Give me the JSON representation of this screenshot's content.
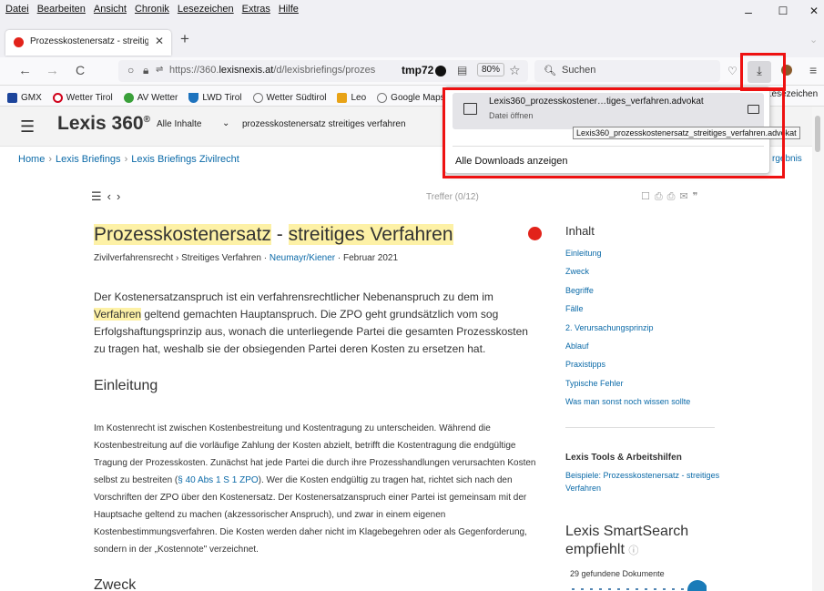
{
  "menu": [
    "Datei",
    "Bearbeiten",
    "Ansicht",
    "Chronik",
    "Lesezeichen",
    "Extras",
    "Hilfe"
  ],
  "window": {
    "minimize": "–",
    "maximize": "☐",
    "close": "✕"
  },
  "tab": {
    "title": "Prozesskostenersatz - streitiges",
    "close": "✕",
    "new": "+"
  },
  "nav": {
    "back": "←",
    "forward": "→",
    "reload": "C",
    "url_prefix": "https://360.",
    "url_domain": "lexisnexis.at",
    "url_rest": "/d/lexisbriefings/prozes",
    "url_tail": "tmp72",
    "zoom": "80%",
    "search_placeholder": "Suchen"
  },
  "bookmarks": [
    {
      "label": "GMX",
      "color": "#1c449b"
    },
    {
      "label": "Wetter Tirol",
      "color": "#d0021b"
    },
    {
      "label": "AV Wetter",
      "color": "#3aa03a"
    },
    {
      "label": "LWD Tirol",
      "color": "#1e73be"
    },
    {
      "label": "Wetter Südtirol",
      "color": "#777777"
    },
    {
      "label": "Leo",
      "color": "#e8a317"
    },
    {
      "label": "Google Maps",
      "color": "#777777"
    }
  ],
  "bookmarks_more": "Lesezeichen",
  "lexis": {
    "logo": "Lexis 360",
    "logo_reg": "®",
    "scope": "Alle Inhalte",
    "query": "prozesskostenersatz streitiges verfahren",
    "breadcrumb": [
      "Home",
      "Lexis Briefings",
      "Lexis Briefings Zivilrecht"
    ],
    "breadcrumb_right": "rgebnis",
    "treffer": "Treffer (0/12)",
    "doc": {
      "title_a": "Prozesskostenersatz",
      "title_sep": " - ",
      "title_b": "streitiges Verfahren",
      "meta_a": "Zivilverfahrensrecht › Streitiges Verfahren ·",
      "meta_author": "Neumayr/Kiener",
      "meta_date": "· Februar 2021",
      "intro_1": "Der Kostenersatzanspruch ist ein verfahrensrechtlicher Nebenanspruch zu dem im",
      "intro_hl": "Verfahren",
      "intro_2": " geltend gemachten Hauptanspruch. Die ZPO geht grundsätzlich vom sog Erfolgshaftungsprinzip aus, wonach die unterliegende Partei die gesamten Prozesskosten zu tragen hat, weshalb sie der obsiegenden Partei deren Kosten zu ersetzen hat.",
      "h_einleitung": "Einleitung",
      "body_1": "Im Kostenrecht ist zwischen Kostenbestreitung und Kostentragung zu unterscheiden. Während die Kostenbestreitung auf die vorläufige Zahlung der Kosten abzielt, betrifft die Kostentragung die endgültige Tragung der Prozesskosten. Zunächst hat jede Partei die durch ihre Prozesshandlungen verursachten Kosten selbst zu bestreiten (",
      "body_link": "§ 40 Abs 1 S 1 ZPO",
      "body_2": "). Wer die Kosten endgültig zu tragen hat, richtet sich nach den Vorschriften der ZPO über den Kostenersatz. Der Kostenersatzanspruch einer Partei ist gemeinsam mit der Hauptsache geltend zu machen (akzessorischer Anspruch), und zwar in einem eigenen Kostenbestimmungsverfahren. Die Kosten werden daher nicht im Klagebegehren oder als Gegenforderung, sondern in der „Kostennote\" verzeichnet.",
      "h_zweck": "Zweck"
    },
    "toc_title": "Inhalt",
    "toc": [
      "Einleitung",
      "Zweck",
      "Begriffe",
      "Fälle",
      "2. Verursachungsprinzip",
      "Ablauf",
      "Praxistipps",
      "Typische Fehler",
      "Was man sonst noch wissen sollte"
    ],
    "tools_title": "Lexis Tools & Arbeitshilfen",
    "tools_link": "Beispiele: Prozesskostenersatz - streitiges Verfahren",
    "smartsearch_title": "Lexis SmartSearch empfiehlt",
    "smartsearch_count": "29 gefundene Dokumente"
  },
  "downloads": {
    "filename": "Lexis360_prozesskostener…tiges_verfahren.advokat",
    "status": "Datei öffnen",
    "tooltip": "Lexis360_prozesskostenersatz_streitiges_verfahren.advokat",
    "show_all": "Alle Downloads anzeigen"
  },
  "colors": {
    "accent": "#0b6aa8",
    "highlight": "#fdf1a6",
    "brand_red": "#e2231a",
    "annotation": "#e11111"
  }
}
